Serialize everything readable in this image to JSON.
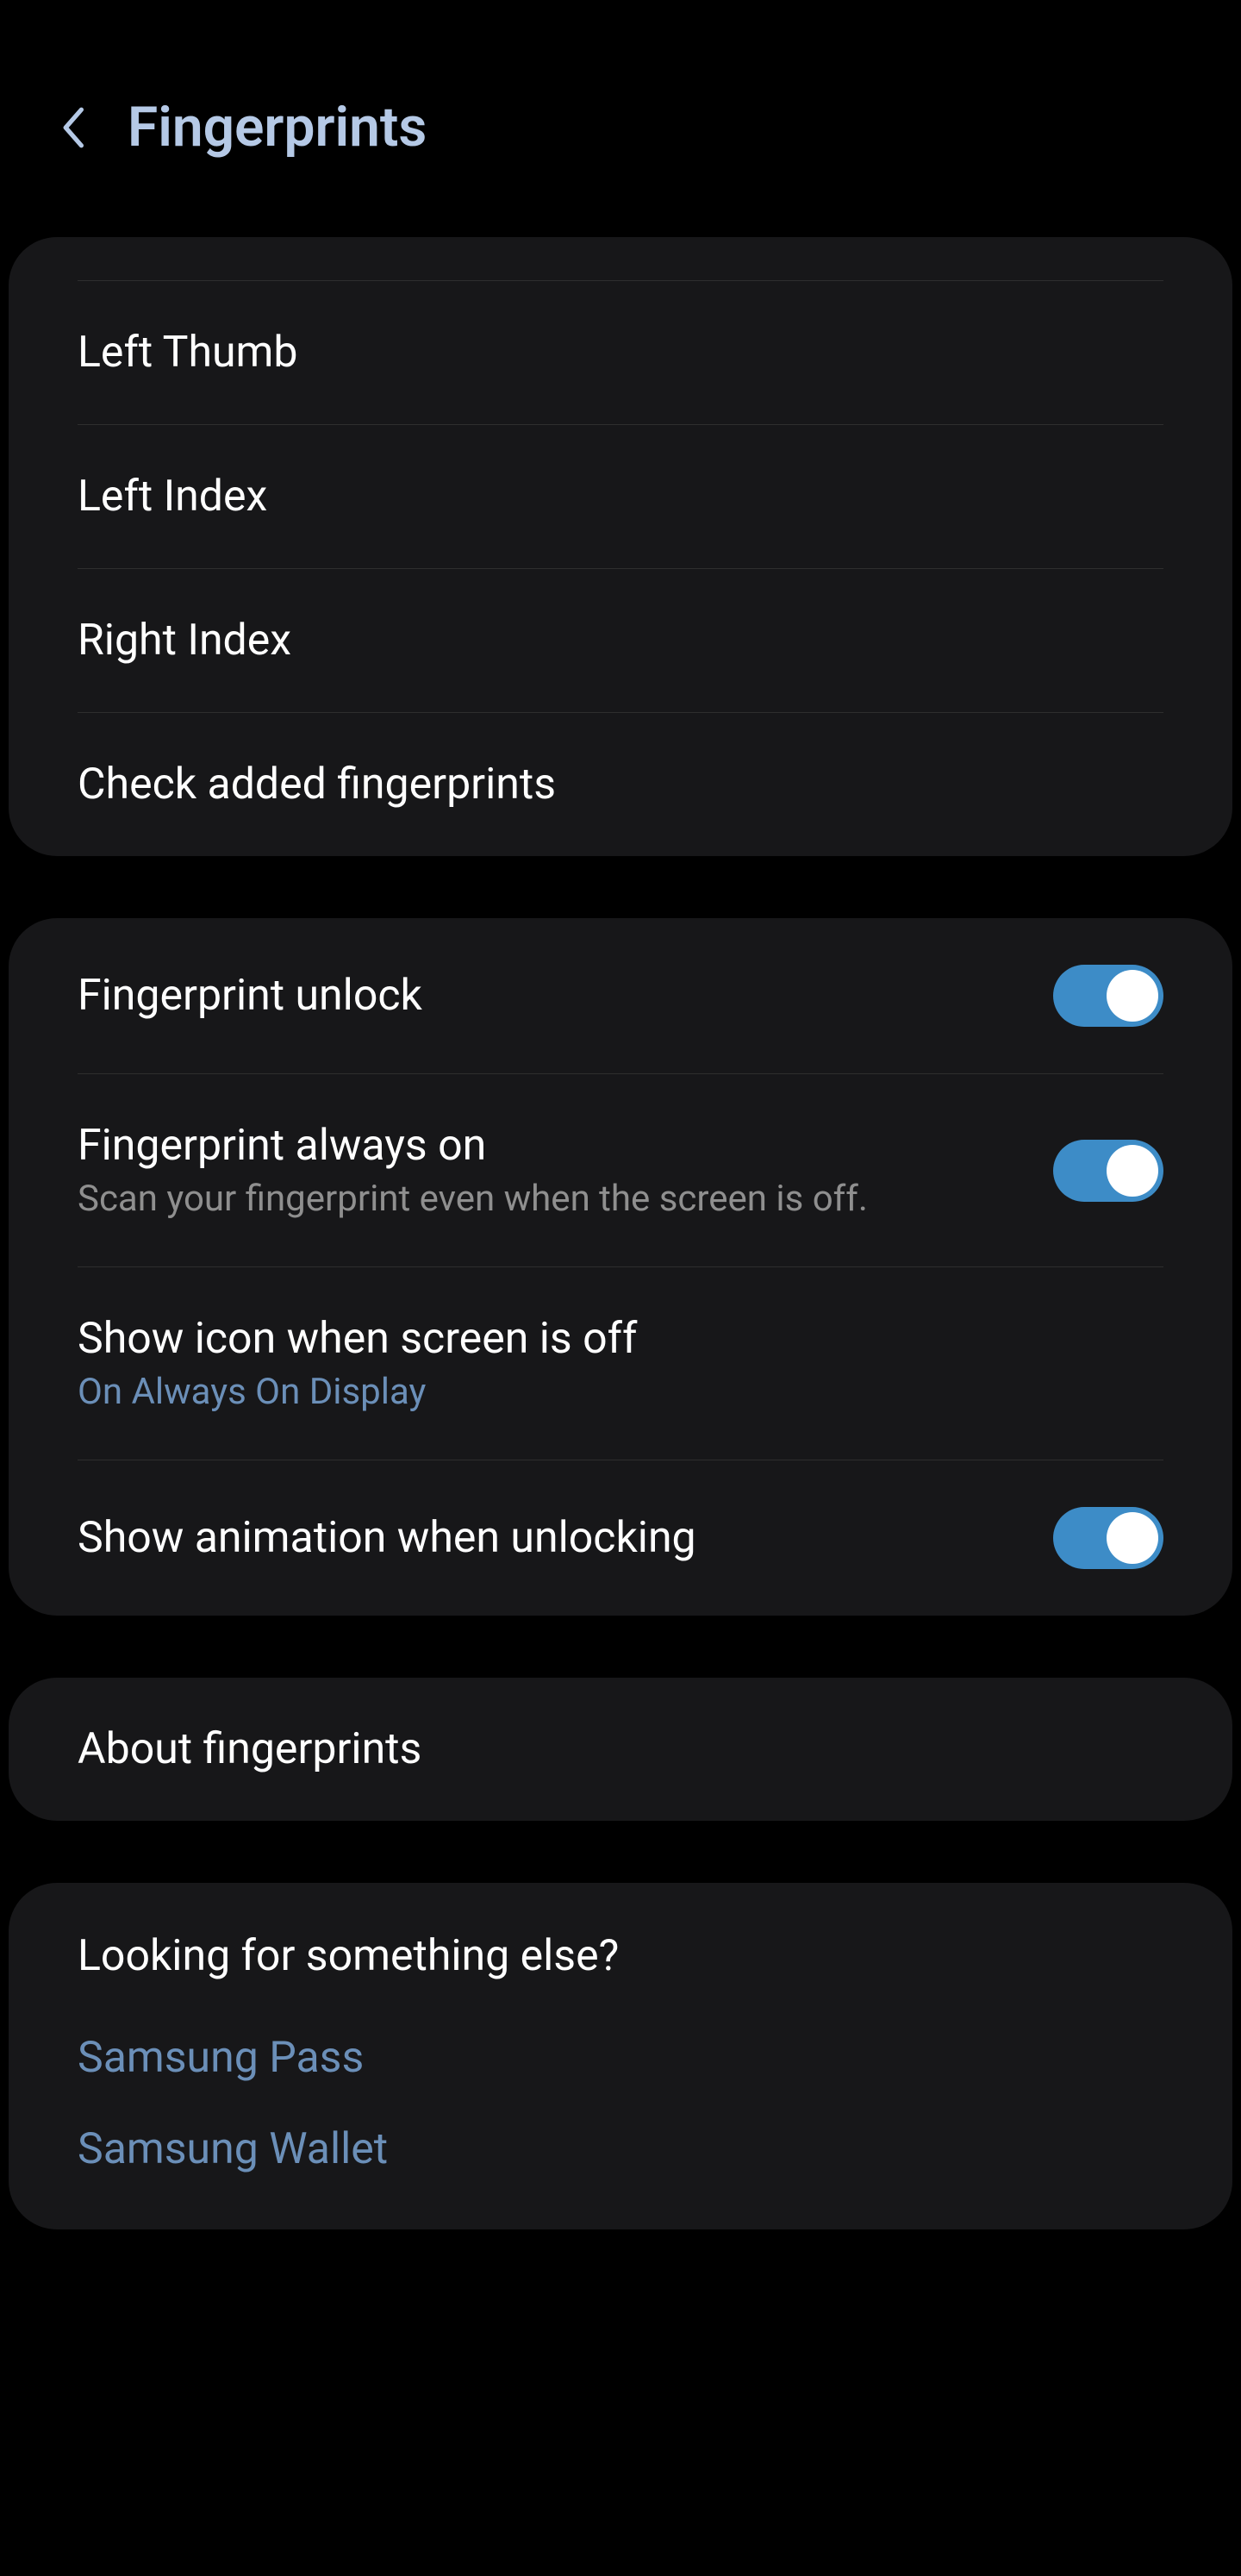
{
  "header": {
    "title": "Fingerprints"
  },
  "fingerprints": {
    "items": [
      "Left Thumb",
      "Left Index",
      "Right Index"
    ],
    "check_label": "Check added fingerprints"
  },
  "settings": {
    "unlock": {
      "title": "Fingerprint unlock"
    },
    "always_on": {
      "title": "Fingerprint always on",
      "subtitle": "Scan your fingerprint even when the screen is off."
    },
    "show_icon": {
      "title": "Show icon when screen is off",
      "subtitle": "On Always On Display"
    },
    "animation": {
      "title": "Show animation when unlocking"
    }
  },
  "about": {
    "title": "About fingerprints"
  },
  "more": {
    "header": "Looking for something else?",
    "links": [
      "Samsung Pass",
      "Samsung Wallet"
    ]
  }
}
